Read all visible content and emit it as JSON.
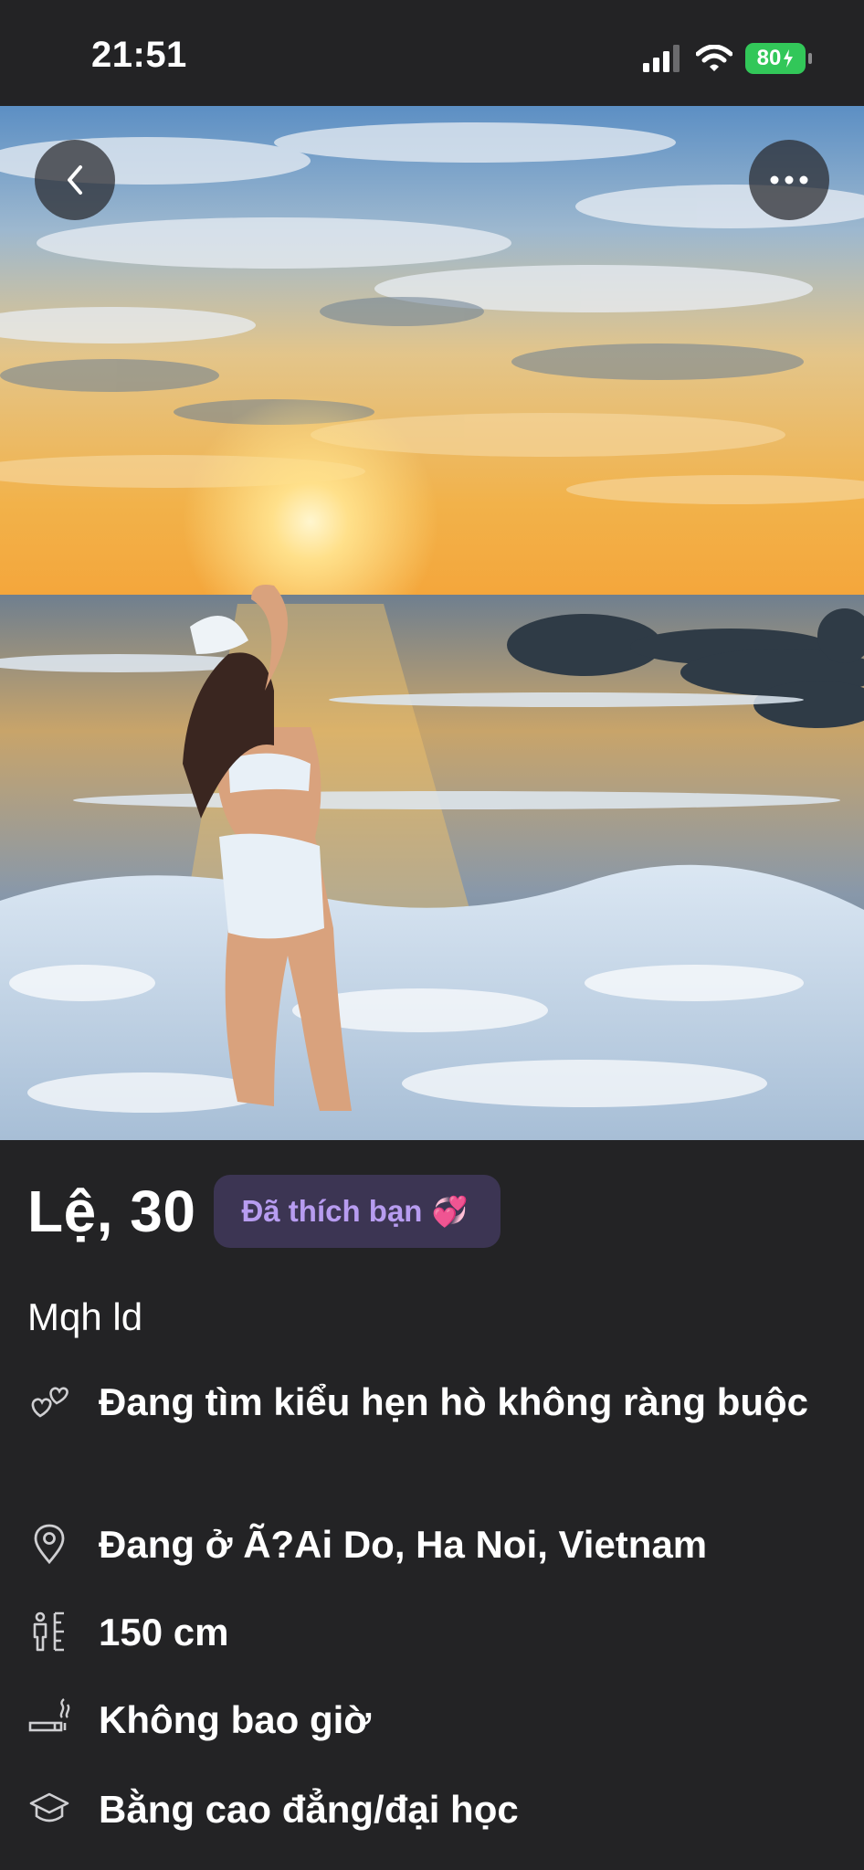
{
  "status_bar": {
    "time": "21:51",
    "battery": "80",
    "icons": [
      "cellular-signal-icon",
      "wifi-icon",
      "battery-charging-icon"
    ]
  },
  "photo": {
    "description_icons": [
      "back-icon",
      "more-icon"
    ]
  },
  "profile": {
    "name_age": "Lệ, 30",
    "liked_badge": "Đã thích bạn",
    "liked_badge_emoji": "💞",
    "subtitle": "Mqh ld",
    "details": [
      {
        "icon": "hearts-icon",
        "text": "Đang tìm kiểu hẹn hò không ràng buộc"
      },
      {
        "icon": "location-pin-icon",
        "text": "Đang ở Ã?Ai Do, Ha Noi, Vietnam"
      },
      {
        "icon": "height-icon",
        "text": "150 cm"
      },
      {
        "icon": "smoking-icon",
        "text": "Không bao giờ"
      },
      {
        "icon": "education-icon",
        "text": "Bằng cao đẳng/đại học"
      }
    ]
  },
  "colors": {
    "background": "#232325",
    "badge_bg": "#3c3553",
    "badge_text": "#b79cf0",
    "battery": "#32c759"
  }
}
